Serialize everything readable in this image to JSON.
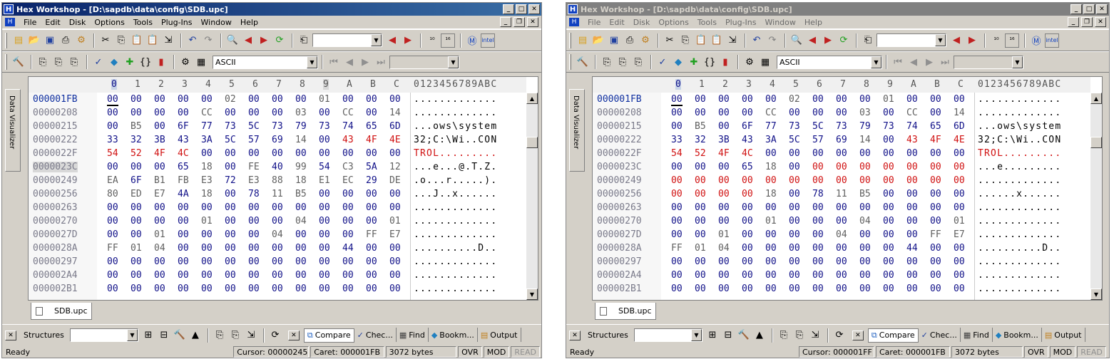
{
  "windows": [
    {
      "title": "Hex Workshop - [D:\\sapdb\\data\\config\\SDB.upc]",
      "menus": [
        "File",
        "Edit",
        "Disk",
        "Options",
        "Tools",
        "Plug-Ins",
        "Window",
        "Help"
      ],
      "encoding": "ASCII",
      "sidebar_label": "Data Visualizer",
      "header_cols": [
        "0",
        "1",
        "2",
        "3",
        "4",
        "5",
        "6",
        "7",
        "8",
        "9",
        "A",
        "B",
        "C"
      ],
      "header_ascii": "0123456789ABC",
      "rows": [
        {
          "addr": "000001FB",
          "hex": [
            "00",
            "00",
            "00",
            "00",
            "00",
            "02",
            "00",
            "00",
            "00",
            "01",
            "00",
            "00",
            "00"
          ],
          "ascii": "............."
        },
        {
          "addr": "00000208",
          "hex": [
            "00",
            "00",
            "00",
            "00",
            "CC",
            "00",
            "00",
            "00",
            "03",
            "00",
            "CC",
            "00",
            "14"
          ],
          "ascii": "............."
        },
        {
          "addr": "00000215",
          "hex": [
            "00",
            "B5",
            "00",
            "6F",
            "77",
            "73",
            "5C",
            "73",
            "79",
            "73",
            "74",
            "65",
            "6D"
          ],
          "ascii": "...ows\\system"
        },
        {
          "addr": "00000222",
          "hex": [
            "33",
            "32",
            "3B",
            "43",
            "3A",
            "5C",
            "57",
            "69",
            "14",
            "00",
            "43",
            "4F",
            "4E"
          ],
          "ascii": "32;C:\\Wi..CON"
        },
        {
          "addr": "0000022F",
          "hex": [
            "54",
            "52",
            "4F",
            "4C",
            "00",
            "00",
            "00",
            "00",
            "00",
            "00",
            "00",
            "00",
            "00"
          ],
          "ascii": "TROL........."
        },
        {
          "addr": "0000023C",
          "hex": [
            "00",
            "00",
            "00",
            "65",
            "18",
            "00",
            "FE",
            "40",
            "99",
            "54",
            "C3",
            "5A",
            "12"
          ],
          "ascii": "...e...@.T.Z."
        },
        {
          "addr": "00000249",
          "hex": [
            "EA",
            "6F",
            "B1",
            "FB",
            "E3",
            "72",
            "E3",
            "88",
            "18",
            "E1",
            "EC",
            "29",
            "DE"
          ],
          "ascii": ".o...r.....)."
        },
        {
          "addr": "00000256",
          "hex": [
            "80",
            "ED",
            "E7",
            "4A",
            "18",
            "00",
            "78",
            "11",
            "B5",
            "00",
            "00",
            "00",
            "00"
          ],
          "ascii": "...J..x......"
        },
        {
          "addr": "00000263",
          "hex": [
            "00",
            "00",
            "00",
            "00",
            "00",
            "00",
            "00",
            "00",
            "00",
            "00",
            "00",
            "00",
            "00"
          ],
          "ascii": "............."
        },
        {
          "addr": "00000270",
          "hex": [
            "00",
            "00",
            "00",
            "00",
            "01",
            "00",
            "00",
            "00",
            "04",
            "00",
            "00",
            "00",
            "01"
          ],
          "ascii": "............."
        },
        {
          "addr": "0000027D",
          "hex": [
            "00",
            "00",
            "01",
            "00",
            "00",
            "00",
            "00",
            "04",
            "00",
            "00",
            "00",
            "FF",
            "E7"
          ],
          "ascii": "............."
        },
        {
          "addr": "0000028A",
          "hex": [
            "FF",
            "01",
            "04",
            "00",
            "00",
            "00",
            "00",
            "00",
            "00",
            "00",
            "44",
            "00",
            "00"
          ],
          "ascii": "..........D.."
        },
        {
          "addr": "00000297",
          "hex": [
            "00",
            "00",
            "00",
            "00",
            "00",
            "00",
            "00",
            "00",
            "00",
            "00",
            "00",
            "00",
            "00"
          ],
          "ascii": "............."
        },
        {
          "addr": "000002A4",
          "hex": [
            "00",
            "00",
            "00",
            "00",
            "00",
            "00",
            "00",
            "00",
            "00",
            "00",
            "00",
            "00",
            "00"
          ],
          "ascii": "............."
        },
        {
          "addr": "000002B1",
          "hex": [
            "00",
            "00",
            "00",
            "00",
            "00",
            "00",
            "00",
            "00",
            "00",
            "00",
            "00",
            "00",
            "00"
          ],
          "ascii": "............."
        }
      ],
      "doc_tab": "SDB.upc",
      "structures_label": "Structures",
      "pane_tabs": [
        "Compare",
        "Chec...",
        "Find",
        "Bookm...",
        "Output"
      ],
      "status": {
        "ready": "Ready",
        "cursor": "Cursor: 00000245",
        "caret": "Caret: 000001FB",
        "size": "3072 bytes",
        "ovr": "OVR",
        "mod": "MOD",
        "read": "READ"
      }
    },
    {
      "title": "Hex Workshop - [D:\\sapdb\\data\\config\\SDB.upc]",
      "menus": [
        "File",
        "Edit",
        "Disk",
        "Options",
        "Tools",
        "Plug-Ins",
        "Window",
        "Help"
      ],
      "encoding": "ASCII",
      "sidebar_label": "Data Visualizer",
      "header_cols": [
        "0",
        "1",
        "2",
        "3",
        "4",
        "5",
        "6",
        "7",
        "8",
        "9",
        "A",
        "B",
        "C"
      ],
      "header_ascii": "0123456789ABC",
      "rows": [
        {
          "addr": "000001FB",
          "hex": [
            "00",
            "00",
            "00",
            "00",
            "00",
            "02",
            "00",
            "00",
            "00",
            "01",
            "00",
            "00",
            "00"
          ],
          "ascii": "............."
        },
        {
          "addr": "00000208",
          "hex": [
            "00",
            "00",
            "00",
            "00",
            "CC",
            "00",
            "00",
            "00",
            "03",
            "00",
            "CC",
            "00",
            "14"
          ],
          "ascii": "............."
        },
        {
          "addr": "00000215",
          "hex": [
            "00",
            "B5",
            "00",
            "6F",
            "77",
            "73",
            "5C",
            "73",
            "79",
            "73",
            "74",
            "65",
            "6D"
          ],
          "ascii": "...ows\\system"
        },
        {
          "addr": "00000222",
          "hex": [
            "33",
            "32",
            "3B",
            "43",
            "3A",
            "5C",
            "57",
            "69",
            "14",
            "00",
            "43",
            "4F",
            "4E"
          ],
          "ascii": "32;C:\\Wi..CON"
        },
        {
          "addr": "0000022F",
          "hex": [
            "54",
            "52",
            "4F",
            "4C",
            "00",
            "00",
            "00",
            "00",
            "00",
            "00",
            "00",
            "00",
            "00"
          ],
          "ascii": "TROL........."
        },
        {
          "addr": "0000023C",
          "hex": [
            "00",
            "00",
            "00",
            "65",
            "18",
            "00",
            "00",
            "00",
            "00",
            "00",
            "00",
            "00",
            "00"
          ],
          "ascii": "...e........."
        },
        {
          "addr": "00000249",
          "hex": [
            "00",
            "00",
            "00",
            "00",
            "00",
            "00",
            "00",
            "00",
            "00",
            "00",
            "00",
            "00",
            "00"
          ],
          "ascii": "............."
        },
        {
          "addr": "00000256",
          "hex": [
            "00",
            "00",
            "00",
            "00",
            "18",
            "00",
            "78",
            "11",
            "B5",
            "00",
            "00",
            "00",
            "00"
          ],
          "ascii": "......x......"
        },
        {
          "addr": "00000263",
          "hex": [
            "00",
            "00",
            "00",
            "00",
            "00",
            "00",
            "00",
            "00",
            "00",
            "00",
            "00",
            "00",
            "00"
          ],
          "ascii": "............."
        },
        {
          "addr": "00000270",
          "hex": [
            "00",
            "00",
            "00",
            "00",
            "01",
            "00",
            "00",
            "00",
            "04",
            "00",
            "00",
            "00",
            "01"
          ],
          "ascii": "............."
        },
        {
          "addr": "0000027D",
          "hex": [
            "00",
            "00",
            "01",
            "00",
            "00",
            "00",
            "00",
            "04",
            "00",
            "00",
            "00",
            "FF",
            "E7"
          ],
          "ascii": "............."
        },
        {
          "addr": "0000028A",
          "hex": [
            "FF",
            "01",
            "04",
            "00",
            "00",
            "00",
            "00",
            "00",
            "00",
            "00",
            "44",
            "00",
            "00"
          ],
          "ascii": "..........D.."
        },
        {
          "addr": "00000297",
          "hex": [
            "00",
            "00",
            "00",
            "00",
            "00",
            "00",
            "00",
            "00",
            "00",
            "00",
            "00",
            "00",
            "00"
          ],
          "ascii": "............."
        },
        {
          "addr": "000002A4",
          "hex": [
            "00",
            "00",
            "00",
            "00",
            "00",
            "00",
            "00",
            "00",
            "00",
            "00",
            "00",
            "00",
            "00"
          ],
          "ascii": "............."
        },
        {
          "addr": "000002B1",
          "hex": [
            "00",
            "00",
            "00",
            "00",
            "00",
            "00",
            "00",
            "00",
            "00",
            "00",
            "00",
            "00",
            "00"
          ],
          "ascii": "............."
        }
      ],
      "doc_tab": "SDB.upc",
      "structures_label": "Structures",
      "pane_tabs": [
        "Compare",
        "Chec...",
        "Find",
        "Bookm...",
        "Output"
      ],
      "status": {
        "ready": "Ready",
        "cursor": "Cursor: 000001FF",
        "caret": "Caret: 000001FB",
        "size": "3072 bytes",
        "ovr": "OVR",
        "mod": "MOD",
        "read": "READ"
      }
    }
  ],
  "colors": {
    "title_active": "#0a246a",
    "title_inactive": "#808080",
    "hex_value": "#101088",
    "hex_diff": "#d01010",
    "chrome": "#d4d0c8"
  }
}
